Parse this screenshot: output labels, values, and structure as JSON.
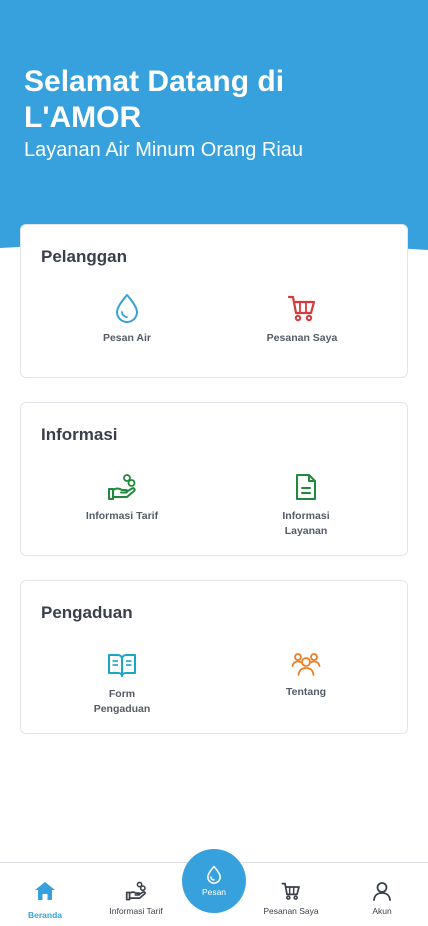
{
  "header": {
    "title": "Selamat Datang di L'AMOR",
    "subtitle": "Layanan Air Minum Orang Riau"
  },
  "colors": {
    "primary": "#36a1dc",
    "red": "#d63a3a",
    "green": "#1f8a3b",
    "orange": "#ef7d22",
    "teal": "#18a7c9"
  },
  "sections": {
    "pelanggan": {
      "title": "Pelanggan",
      "items": [
        {
          "label": "Pesan Air",
          "icon": "water-drop-icon"
        },
        {
          "label": "Pesanan Saya",
          "icon": "shopping-cart-icon"
        }
      ]
    },
    "informasi": {
      "title": "Informasi",
      "items": [
        {
          "label": "Informasi Tarif",
          "icon": "hand-coins-icon"
        },
        {
          "label": "Informasi\nLayanan",
          "icon": "document-icon"
        }
      ]
    },
    "pengaduan": {
      "title": "Pengaduan",
      "items": [
        {
          "label": "Form\nPengaduan",
          "icon": "open-book-icon"
        },
        {
          "label": "Tentang",
          "icon": "users-group-icon"
        }
      ]
    }
  },
  "bottom_nav": {
    "items": [
      {
        "label": "Beranda",
        "icon": "home-icon",
        "active": true
      },
      {
        "label": "Informasi Tarif",
        "icon": "hand-coins-icon"
      },
      {
        "label": "Pesan",
        "icon": "water-drop-icon"
      },
      {
        "label": "Pesanan Saya",
        "icon": "shopping-cart-icon"
      },
      {
        "label": "Akun",
        "icon": "user-icon"
      }
    ]
  }
}
